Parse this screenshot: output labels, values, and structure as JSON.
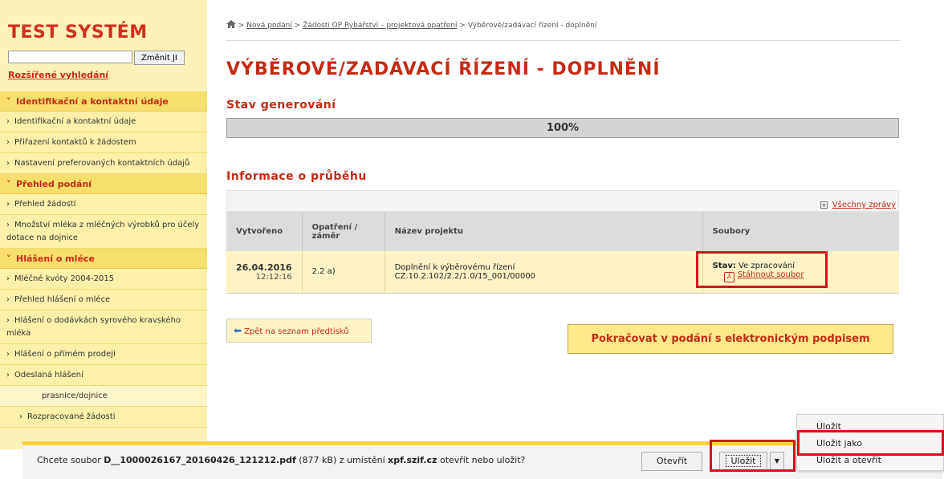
{
  "sidebar": {
    "logo": "TEST SYSTÉM",
    "search_button": "Změnit JI",
    "advanced_search": "Rozšířené vyhledání",
    "groups": [
      {
        "title": "Identifikační a kontaktní údaje",
        "items": [
          "Identifikační a kontaktní údaje",
          "Přiřazení kontaktů k žádostem",
          "Nastavení preferovaných kontaktních údajů"
        ]
      },
      {
        "title": "Přehled podání",
        "items": [
          "Přehled žádostí",
          "Množství mléka z mléčných výrobků pro účely dotace na dojnice"
        ]
      },
      {
        "title": "Hlášení o mléce",
        "items": [
          "Mléčné kvóty 2004-2015",
          "Přehled hlášení o mléce",
          "Hlášení o dodávkách syrového kravského mléka",
          "Hlášení o přímém prodeji",
          "Odeslaná hlášení"
        ]
      }
    ],
    "sub_item": "prasnice/dojnice",
    "extra_item": "Rozpracované žádosti"
  },
  "breadcrumb": {
    "sep": ">",
    "link1": "Nová podání",
    "link2": "Žádosti OP Rybářství – projektová opatření",
    "current": "Výběrové/zadávací řízení - doplnění"
  },
  "page_title": "VÝBĚROVÉ/ZADÁVACÍ ŘÍZENÍ - DOPLNĚNÍ",
  "status": {
    "heading": "Stav generování",
    "progress_text": "100%",
    "progress_value": 1.0
  },
  "info": {
    "heading": "Informace o průběhu",
    "all_messages": "Všechny zprávy"
  },
  "table": {
    "headers": [
      "Vytvořeno",
      "Opatření / záměr",
      "Název projektu",
      "Soubory"
    ],
    "row": {
      "date": "26.04.2016",
      "time": "12:12:16",
      "measure": "2.2 a)",
      "project_name": "Doplnění k výběrovému řízení",
      "project_code": "CZ.10.2.102/2.2/1.0/15_001/00000",
      "stav_label": "Stav:",
      "stav_value": "Ve zpracování",
      "download": "Stáhnout soubor"
    }
  },
  "buttons": {
    "back": "Zpět na seznam předtisků",
    "continue": "Pokračovat v podání s elektronickým podpisem"
  },
  "download_bar": {
    "prefix": "Chcete soubor",
    "filename": "D__1000026167_20160426_121212.pdf",
    "size": "(877 kB)",
    "from": "z umístění",
    "host": "xpf.szif.cz",
    "suffix": "otevřít nebo uložit?",
    "open": "Otevřít",
    "save": "Uložit",
    "menu": [
      "Uložit",
      "Uložit jako",
      "Uložit a otevřít"
    ]
  },
  "colors": {
    "accent_red": "#c52a15",
    "highlight_frame": "#d80f1f",
    "sidebar_bg": "#fdf2b8"
  }
}
